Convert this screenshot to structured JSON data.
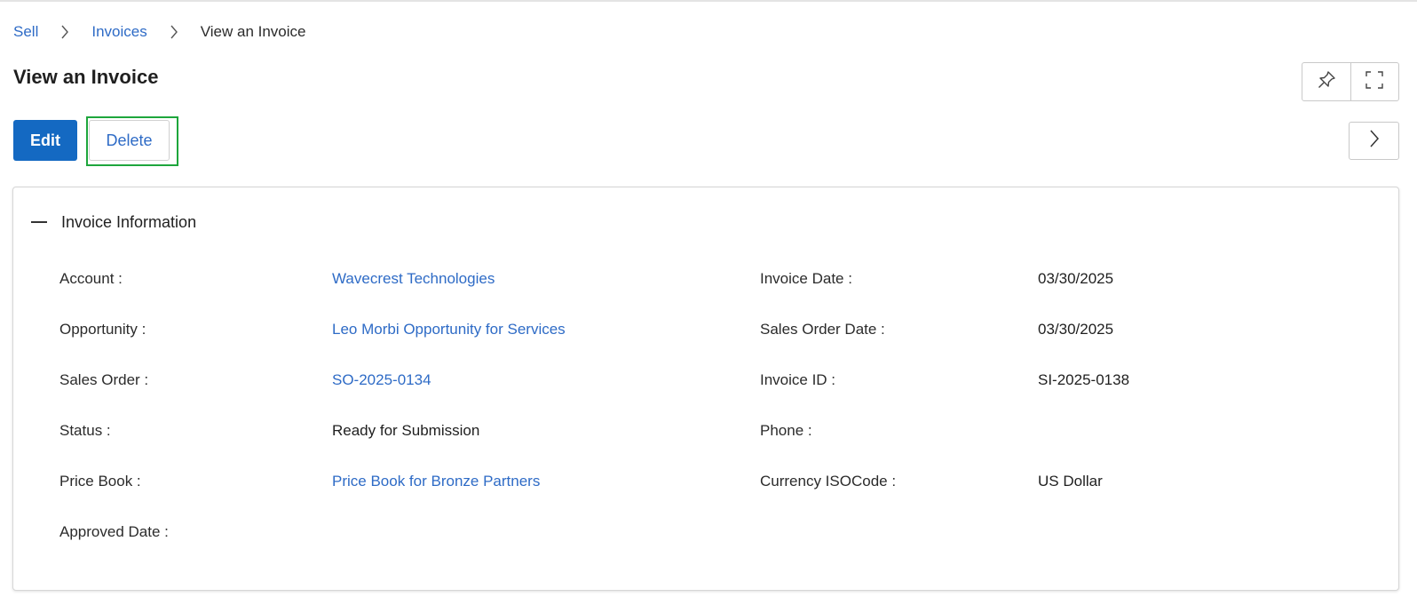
{
  "breadcrumb": {
    "items": [
      "Sell",
      "Invoices"
    ],
    "current": "View an Invoice"
  },
  "page": {
    "title": "View an Invoice"
  },
  "toolbar": {
    "edit_label": "Edit",
    "delete_label": "Delete"
  },
  "icons": {
    "pin": "pin-icon",
    "fullscreen": "fullscreen-icon",
    "next": "chevron-right-icon",
    "collapse": "minus-icon",
    "breadcrumb_separator": "chevron-right-icon"
  },
  "panel": {
    "title": "Invoice Information",
    "left_fields": [
      {
        "label": "Account :",
        "value": "Wavecrest Technologies"
      },
      {
        "label": "Opportunity :",
        "value": "Leo Morbi Opportunity for Services"
      },
      {
        "label": "Sales Order :",
        "value": "SO-2025-0134"
      },
      {
        "label": "Status :",
        "value": "Ready for Submission"
      },
      {
        "label": "Price Book :",
        "value": "Price Book for Bronze Partners"
      },
      {
        "label": "Approved Date :",
        "value": ""
      }
    ],
    "right_fields": [
      {
        "label": "Invoice Date :",
        "value": "03/30/2025"
      },
      {
        "label": "Sales Order Date :",
        "value": "03/30/2025"
      },
      {
        "label": "Invoice ID :",
        "value": "SI-2025-0138"
      },
      {
        "label": "Phone :",
        "value": ""
      },
      {
        "label": "Currency ISOCode :",
        "value": "US Dollar"
      }
    ]
  },
  "colors": {
    "primary": "#1469c2",
    "link": "#2e6bc6",
    "highlight": "#1ea63c",
    "border": "#d6d6d6"
  }
}
